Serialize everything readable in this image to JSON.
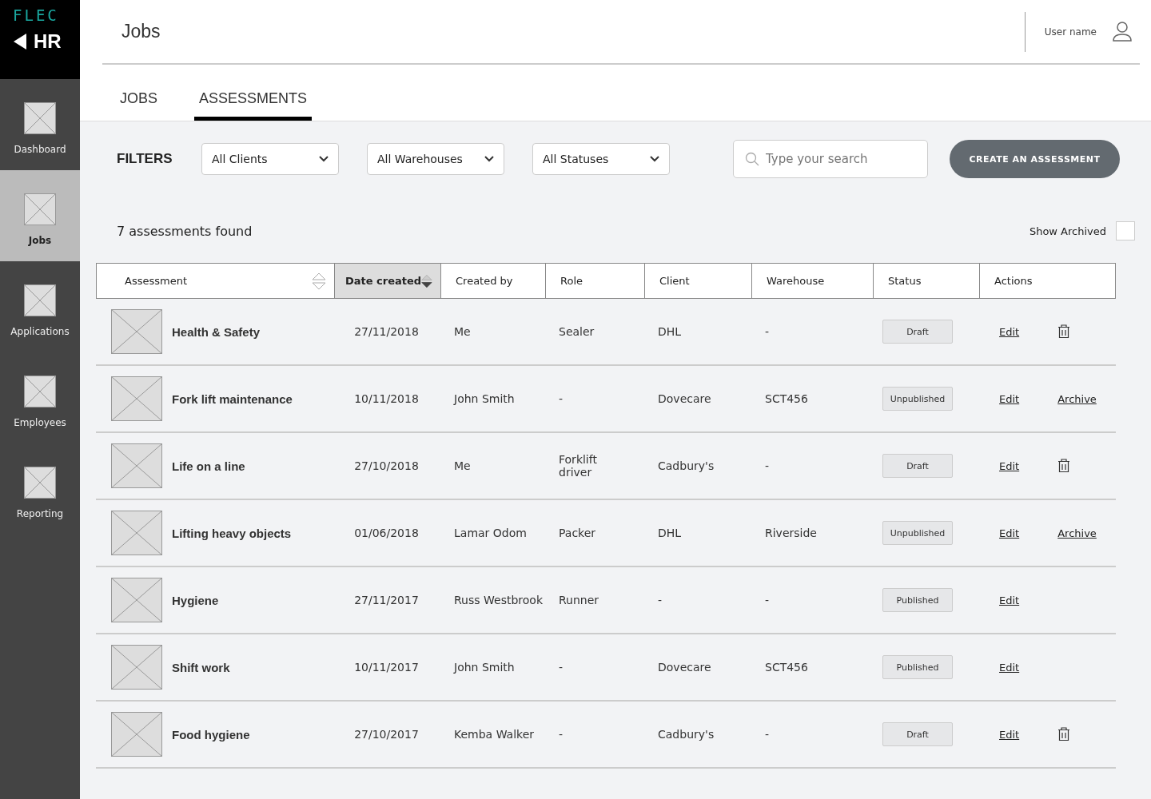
{
  "logo": {
    "brand": "FLEC",
    "section": "HR"
  },
  "nav": [
    {
      "label": "Dashboard",
      "selected": false
    },
    {
      "label": "Jobs",
      "selected": true
    },
    {
      "label": "Applications",
      "selected": false
    },
    {
      "label": "Employees",
      "selected": false
    },
    {
      "label": "Reporting",
      "selected": false
    }
  ],
  "header": {
    "title": "Jobs",
    "user": "User name"
  },
  "tabs": [
    {
      "label": "JOBS",
      "selected": false
    },
    {
      "label": "ASSESSMENTS",
      "selected": true
    }
  ],
  "filters": {
    "label": "FILTERS",
    "dropdowns": [
      "All Clients",
      "All Warehouses",
      "All Statuses"
    ],
    "search_placeholder": "Type your search",
    "create_button": "CREATE AN ASSESSMENT"
  },
  "results": {
    "count": "7 assessments found",
    "show_archived": {
      "label": "Show Archived",
      "checked": false
    }
  },
  "table": {
    "columns": [
      {
        "label": "Assessment",
        "sortable": true,
        "selected": false
      },
      {
        "label": "Date created",
        "sortable": true,
        "selected": true
      },
      {
        "label": "Created by",
        "sortable": false,
        "selected": false
      },
      {
        "label": "Role",
        "sortable": false,
        "selected": false
      },
      {
        "label": "Client",
        "sortable": false,
        "selected": false
      },
      {
        "label": "Warehouse",
        "sortable": false,
        "selected": false
      },
      {
        "label": "Status",
        "sortable": false,
        "selected": false
      },
      {
        "label": "Actions",
        "sortable": false,
        "selected": false
      }
    ],
    "rows": [
      {
        "name": "Health & Safety",
        "date": "27/11/2018",
        "created_by": "Me",
        "role": "Sealer",
        "client": "DHL",
        "warehouse": "-",
        "status": "Draft",
        "edit": "Edit",
        "action_2": {
          "kind": "delete"
        }
      },
      {
        "name": "Fork lift maintenance",
        "date": "10/11/2018",
        "created_by": "John Smith",
        "role": "-",
        "client": "Dovecare",
        "warehouse": "SCT456",
        "status": "Unpublished",
        "edit": "Edit",
        "action_2": {
          "kind": "archive",
          "label": "Archive"
        }
      },
      {
        "name": "Life on a line",
        "date": "27/10/2018",
        "created_by": "Me",
        "role": "Forklift driver",
        "client": "Cadbury's",
        "warehouse": "-",
        "status": "Draft",
        "edit": "Edit",
        "action_2": {
          "kind": "delete"
        }
      },
      {
        "name": "Lifting heavy objects",
        "date": "01/06/2018",
        "created_by": "Lamar Odom",
        "role": "Packer",
        "client": "DHL",
        "warehouse": "Riverside",
        "status": "Unpublished",
        "edit": "Edit",
        "action_2": {
          "kind": "archive",
          "label": "Archive"
        }
      },
      {
        "name": "Hygiene",
        "date": "27/11/2017",
        "created_by": "Russ Westbrook",
        "role": "Runner",
        "client": "-",
        "warehouse": "-",
        "status": "Published",
        "edit": "Edit",
        "action_2": {
          "kind": "none"
        }
      },
      {
        "name": "Shift work",
        "date": "10/11/2017",
        "created_by": "John Smith",
        "role": "-",
        "client": "Dovecare",
        "warehouse": "SCT456",
        "status": "Published",
        "edit": "Edit",
        "action_2": {
          "kind": "none"
        }
      },
      {
        "name": "Food hygiene",
        "date": "27/10/2017",
        "created_by": "Kemba Walker",
        "role": "-",
        "client": "Cadbury's",
        "warehouse": "-",
        "status": "Draft",
        "edit": "Edit",
        "action_2": {
          "kind": "delete"
        }
      }
    ]
  }
}
